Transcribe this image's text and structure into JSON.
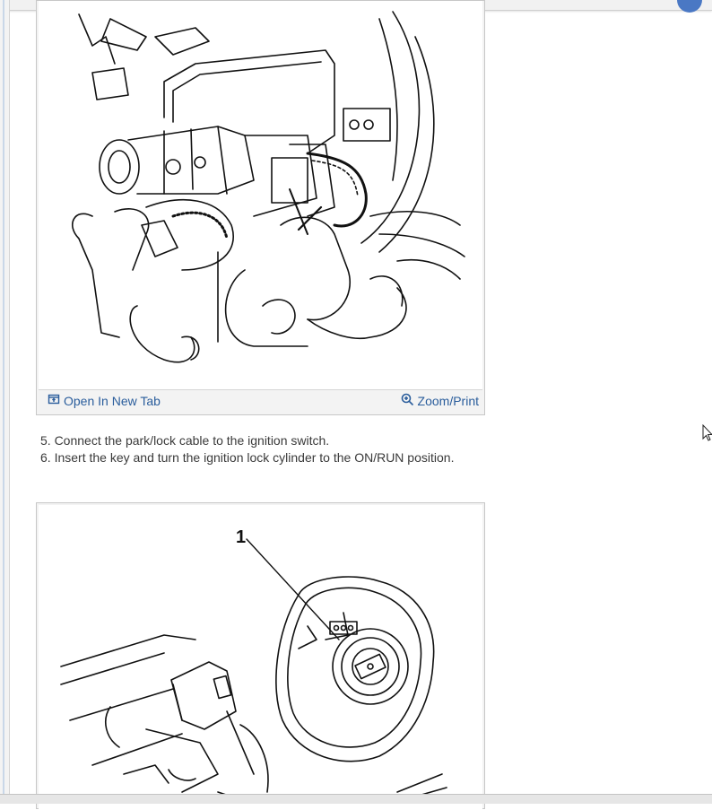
{
  "figure1": {
    "open_tab_label": "Open In New Tab",
    "zoom_print_label": "Zoom/Print",
    "open_tab_icon": "open-new-tab-icon",
    "zoom_icon": "magnifier-plus-icon"
  },
  "steps": [
    "5. Connect the park/lock cable to the ignition switch.",
    "6. Insert the key and turn the ignition lock cylinder to the ON/RUN position."
  ],
  "figure2": {
    "callout_label": "1"
  },
  "colors": {
    "link": "#2a5d9c",
    "text": "#3a3a3a",
    "card_bg": "#f3f3f3"
  }
}
